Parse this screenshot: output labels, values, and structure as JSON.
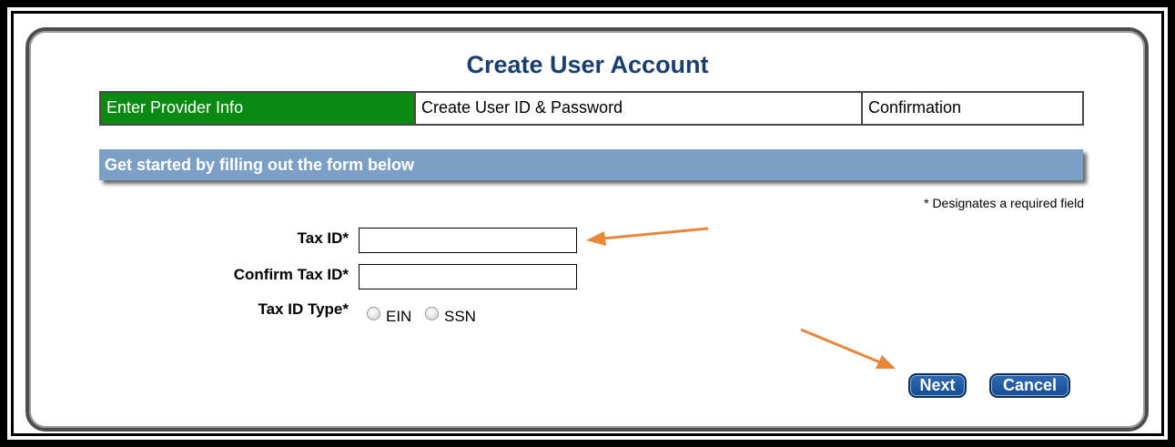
{
  "page": {
    "title": "Create User Account"
  },
  "steps": [
    {
      "label": "Enter Provider Info",
      "active": true
    },
    {
      "label": "Create User ID & Password",
      "active": false
    },
    {
      "label": "Confirmation",
      "active": false
    }
  ],
  "banner": {
    "text": "Get started by filling out the form below"
  },
  "required_note": "* Designates a required field",
  "form": {
    "tax_id_label": "Tax ID*",
    "tax_id_value": "",
    "confirm_tax_id_label": "Confirm Tax ID*",
    "confirm_tax_id_value": "",
    "tax_id_type_label": "Tax ID Type*",
    "tax_id_type_options": [
      "EIN",
      "SSN"
    ],
    "tax_id_type_selected": ""
  },
  "buttons": {
    "next_label": "Next",
    "cancel_label": "Cancel"
  },
  "colors": {
    "title": "#1a3f6f",
    "active_step": "#0b8a11",
    "banner": "#7b9fc5",
    "button": "#1e5aa3",
    "annotation_arrow": "#e8873a"
  },
  "annotations": {
    "arrows": [
      "arrow-pointing-to-tax-id-input",
      "arrow-pointing-to-next-button"
    ]
  }
}
